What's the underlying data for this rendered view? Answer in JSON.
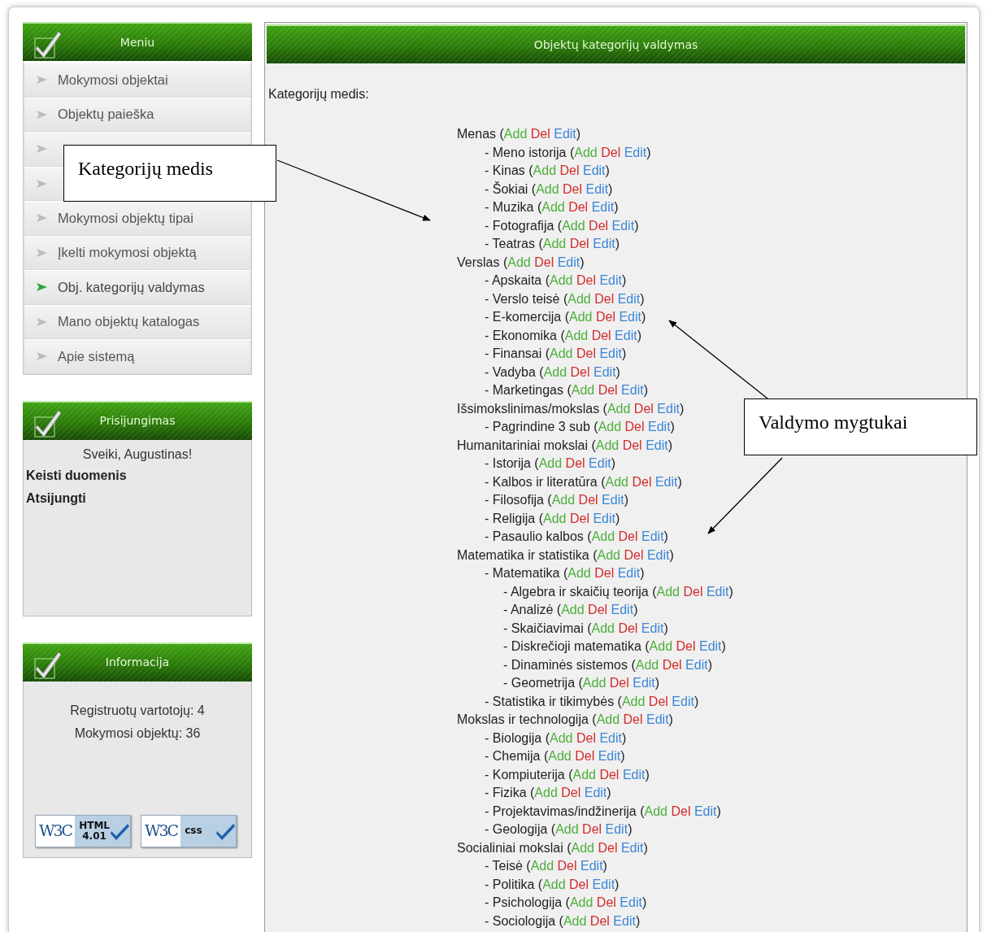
{
  "sidebar": {
    "menu": {
      "title": "Meniu",
      "items": [
        {
          "label": "Mokymosi objektai",
          "selected": false
        },
        {
          "label": "Objektų paieška",
          "selected": false
        },
        {
          "selected": false
        },
        {
          "selected": false
        },
        {
          "label": "Mokymosi objektų tipai",
          "selected": false
        },
        {
          "label": "Įkelti mokymosi objektą",
          "selected": false
        },
        {
          "label": "Obj. kategorijų valdymas",
          "selected": true
        },
        {
          "label": "Mano objektų katalogas",
          "selected": false
        },
        {
          "label": "Apie sistemą",
          "selected": false
        }
      ]
    },
    "login": {
      "title": "Prisijungimas",
      "greeting": "Sveiki, Augustinas!",
      "links": [
        "Keisti duomenis",
        "Atsijungti"
      ]
    },
    "info": {
      "title": "Informacija",
      "lines": [
        "Registruotų vartotojų: 4",
        "Mokymosi objektų: 36"
      ],
      "badges": [
        {
          "logo": "W3C",
          "text": [
            "HTML",
            "4.01"
          ]
        },
        {
          "logo": "W3C",
          "text": [
            "css"
          ]
        }
      ]
    }
  },
  "main": {
    "title": "Objektų kategorijų valdymas",
    "tree_label": "Kategorijų medis:",
    "tree": [
      {
        "label": "Menas",
        "open": "(",
        "actions": [
          "Add",
          "Del",
          "Edit"
        ],
        "close": ")",
        "children": [
          {
            "label": "- Meno istorija",
            "open": "(",
            "actions": [
              "Add",
              "Del",
              "Edit"
            ],
            "close": ")"
          },
          {
            "label": "- Kinas",
            "open": "(",
            "actions": [
              "Add",
              "Del",
              "Edit"
            ],
            "close": ")"
          },
          {
            "label": "- Šokiai",
            "open": "(",
            "actions": [
              "Add",
              "Del",
              "Edit"
            ],
            "close": ")"
          },
          {
            "label": "- Muzika",
            "open": "(",
            "actions": [
              "Add",
              "Del",
              "Edit"
            ],
            "close": ")"
          },
          {
            "label": "- Fotografija",
            "open": "(",
            "actions": [
              "Add",
              "Del",
              "Edit"
            ],
            "close": ")"
          },
          {
            "label": "- Teatras",
            "open": "(",
            "actions": [
              "Add",
              "Del",
              "Edit"
            ],
            "close": ")"
          }
        ]
      },
      {
        "label": "Verslas",
        "open": "(",
        "actions": [
          "Add",
          "Del",
          "Edit"
        ],
        "close": ")",
        "children": [
          {
            "label": "- Apskaita",
            "open": "(",
            "actions": [
              "Add",
              "Del",
              "Edit"
            ],
            "close": ")"
          },
          {
            "label": "- Verslo teisė",
            "open": "(",
            "actions": [
              "Add",
              "Del",
              "Edit"
            ],
            "close": ")"
          },
          {
            "label": "- E-komercija",
            "open": "(",
            "actions": [
              "Add",
              "Del",
              "Edit"
            ],
            "close": ")"
          },
          {
            "label": "- Ekonomika",
            "open": "(",
            "actions": [
              "Add",
              "Del",
              "Edit"
            ],
            "close": ")"
          },
          {
            "label": "- Finansai",
            "open": "(",
            "actions": [
              "Add",
              "Del",
              "Edit"
            ],
            "close": ")"
          },
          {
            "label": "- Vadyba",
            "open": "(",
            "actions": [
              "Add",
              "Del",
              "Edit"
            ],
            "close": ")"
          },
          {
            "label": "- Marketingas",
            "open": "(",
            "actions": [
              "Add",
              "Del",
              "Edit"
            ],
            "close": ")"
          }
        ]
      },
      {
        "label": "Išsimokslinimas/mokslas",
        "open": "(",
        "actions": [
          "Add",
          "Del",
          "Edit"
        ],
        "close": ")",
        "children": [
          {
            "label": "- Pagrindine 3 sub",
            "open": "(",
            "actions": [
              "Add",
              "Del",
              "Edit"
            ],
            "close": ")"
          }
        ]
      },
      {
        "label": "Humanitariniai mokslai",
        "open": "(",
        "actions": [
          "Add",
          "Del",
          "Edit"
        ],
        "close": ")",
        "children": [
          {
            "label": "- Istorija",
            "open": "(",
            "actions": [
              "Add",
              "Del",
              "Edit"
            ],
            "close": ")"
          },
          {
            "label": "- Kalbos ir literatūra",
            "open": "(",
            "actions": [
              "Add",
              "Del",
              "Edit"
            ],
            "close": ")"
          },
          {
            "label": "- Filosofija",
            "open": "(",
            "actions": [
              "Add",
              "Del",
              "Edit"
            ],
            "close": ")"
          },
          {
            "label": "- Religija",
            "open": "(",
            "actions": [
              "Add",
              "Del",
              "Edit"
            ],
            "close": ")"
          },
          {
            "label": "- Pasaulio kalbos",
            "open": "(",
            "actions": [
              "Add",
              "Del",
              "Edit"
            ],
            "close": ")"
          }
        ]
      },
      {
        "label": "Matematika ir statistika",
        "open": "(",
        "actions": [
          "Add",
          "Del",
          "Edit"
        ],
        "close": ")",
        "children": [
          {
            "label": "- Matematika",
            "open": "(",
            "actions": [
              "Add",
              "Del",
              "Edit"
            ],
            "close": ")",
            "children": [
              {
                "label": "- Algebra ir skaičių teorija",
                "open": "(",
                "actions": [
                  "Add",
                  "Del",
                  "Edit"
                ],
                "close": ")"
              },
              {
                "label": "- Analizė",
                "open": "(",
                "actions": [
                  "Add",
                  "Del",
                  "Edit"
                ],
                "close": ")"
              },
              {
                "label": "- Skaičiavimai",
                "open": "(",
                "actions": [
                  "Add",
                  "Del",
                  "Edit"
                ],
                "close": ")"
              },
              {
                "label": "- Diskrečioji matematika",
                "open": "(",
                "actions": [
                  "Add",
                  "Del",
                  "Edit"
                ],
                "close": ")"
              },
              {
                "label": "- Dinaminės sistemos",
                "open": "(",
                "actions": [
                  "Add",
                  "Del",
                  "Edit"
                ],
                "close": ")"
              },
              {
                "label": "- Geometrija",
                "open": "(",
                "actions": [
                  "Add",
                  "Del",
                  "Edit"
                ],
                "close": ")"
              }
            ]
          },
          {
            "label": "- Statistika ir tikimybės",
            "open": "(",
            "actions": [
              "Add",
              "Del",
              "Edit"
            ],
            "close": ")"
          }
        ]
      },
      {
        "label": "Mokslas ir technologija",
        "open": "(",
        "actions": [
          "Add",
          "Del",
          "Edit"
        ],
        "close": ")",
        "children": [
          {
            "label": "- Biologija",
            "open": "(",
            "actions": [
              "Add",
              "Del",
              "Edit"
            ],
            "close": ")"
          },
          {
            "label": "- Chemija",
            "open": "(",
            "actions": [
              "Add",
              "Del",
              "Edit"
            ],
            "close": ")"
          },
          {
            "label": "- Kompiuterija",
            "open": "(",
            "actions": [
              "Add",
              "Del",
              "Edit"
            ],
            "close": ")"
          },
          {
            "label": "- Fizika",
            "open": "(",
            "actions": [
              "Add",
              "Del",
              "Edit"
            ],
            "close": ")"
          },
          {
            "label": "- Projektavimas/indžinerija",
            "open": "(",
            "actions": [
              "Add",
              "Del",
              "Edit"
            ],
            "close": ")"
          },
          {
            "label": "- Geologija",
            "open": "(",
            "actions": [
              "Add",
              "Del",
              "Edit"
            ],
            "close": ")"
          }
        ]
      },
      {
        "label": "Socialiniai mokslai",
        "open": "(",
        "actions": [
          "Add",
          "Del",
          "Edit"
        ],
        "close": ")",
        "children": [
          {
            "label": "- Teisė",
            "open": "(",
            "actions": [
              "Add",
              "Del",
              "Edit"
            ],
            "close": ")"
          },
          {
            "label": "- Politika",
            "open": "(",
            "actions": [
              "Add",
              "Del",
              "Edit"
            ],
            "close": ")"
          },
          {
            "label": "- Psichologija",
            "open": "(",
            "actions": [
              "Add",
              "Del",
              "Edit"
            ],
            "close": ")"
          },
          {
            "label": "- Sociologija",
            "open": "(",
            "actions": [
              "Add",
              "Del",
              "Edit"
            ],
            "close": ")"
          }
        ]
      }
    ]
  },
  "annotations": [
    {
      "text": "Kategorijų medis"
    },
    {
      "text": "Valdymo mygtukai"
    }
  ]
}
